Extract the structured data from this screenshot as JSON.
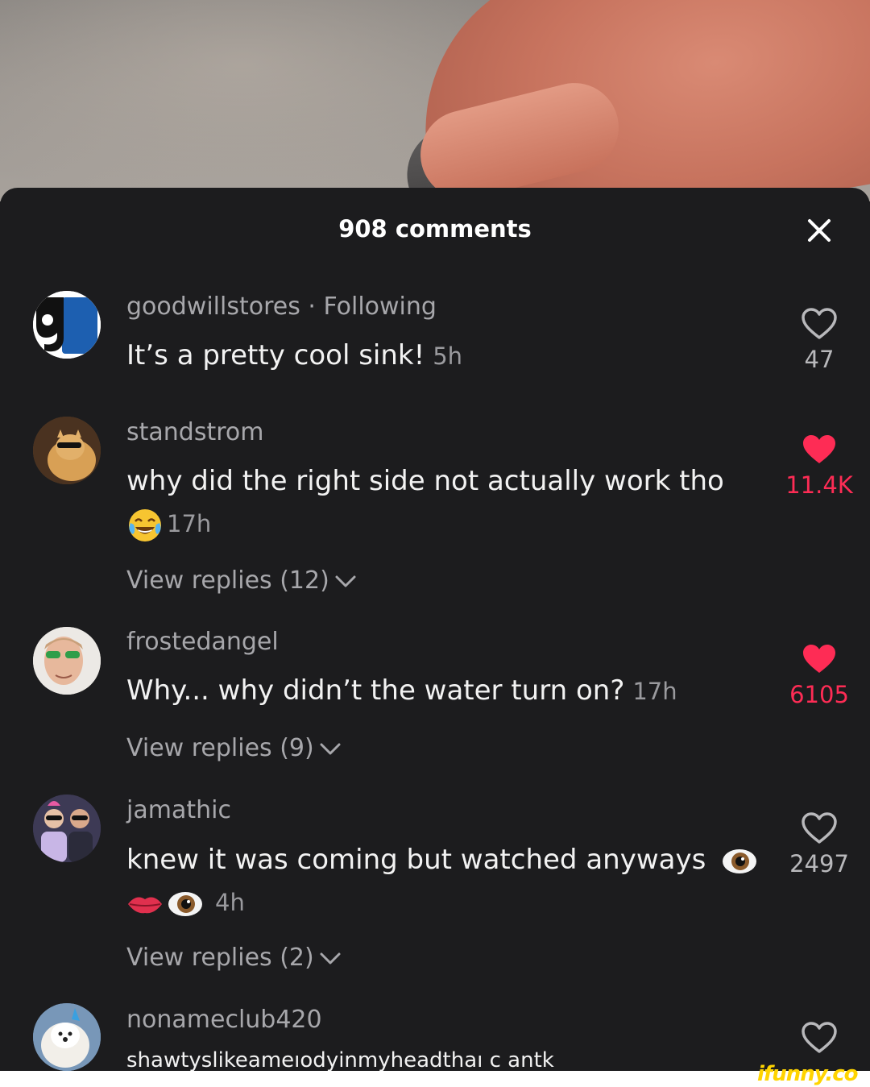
{
  "sheet": {
    "title": "908 comments",
    "close_icon": "close-x-icon"
  },
  "colors": {
    "background": "#1c1c1e",
    "liked": "#fe2c55",
    "muted": "#a7a7ab",
    "watermark": "#ffd400"
  },
  "comments": [
    {
      "username": "goodwillstores · Following",
      "text": "It’s a pretty cool sink!",
      "time": "5h",
      "likes": "47",
      "liked": false,
      "avatar": "goodwill-logo-avatar"
    },
    {
      "username": "standstrom",
      "text": "why did the right side not actually work tho",
      "time": "17h",
      "emoji": "face-with-tears-of-joy",
      "likes": "11.4K",
      "liked": true,
      "replies": "View replies (12)",
      "avatar": "cat-with-sunglasses-avatar"
    },
    {
      "username": "frostedangel",
      "text": "Why... why didn’t the water turn on?",
      "time": "17h",
      "likes": "6105",
      "liked": true,
      "replies": "View replies (9)",
      "avatar": "person-with-green-sunglasses-avatar"
    },
    {
      "username": "jamathic",
      "text": "knew it was coming but watched anyways",
      "time": "4h",
      "emoji": "eye, lips, eye",
      "likes": "2497",
      "liked": false,
      "replies": "View replies (2)",
      "avatar": "group-photo-avatar"
    },
    {
      "username": "nonameclub420",
      "text": "shawtyslikeameıodyinmyheadthaı c antk",
      "likes": "",
      "liked": false,
      "avatar": "white-dog-avatar"
    }
  ],
  "watermark": "ifunny.co"
}
